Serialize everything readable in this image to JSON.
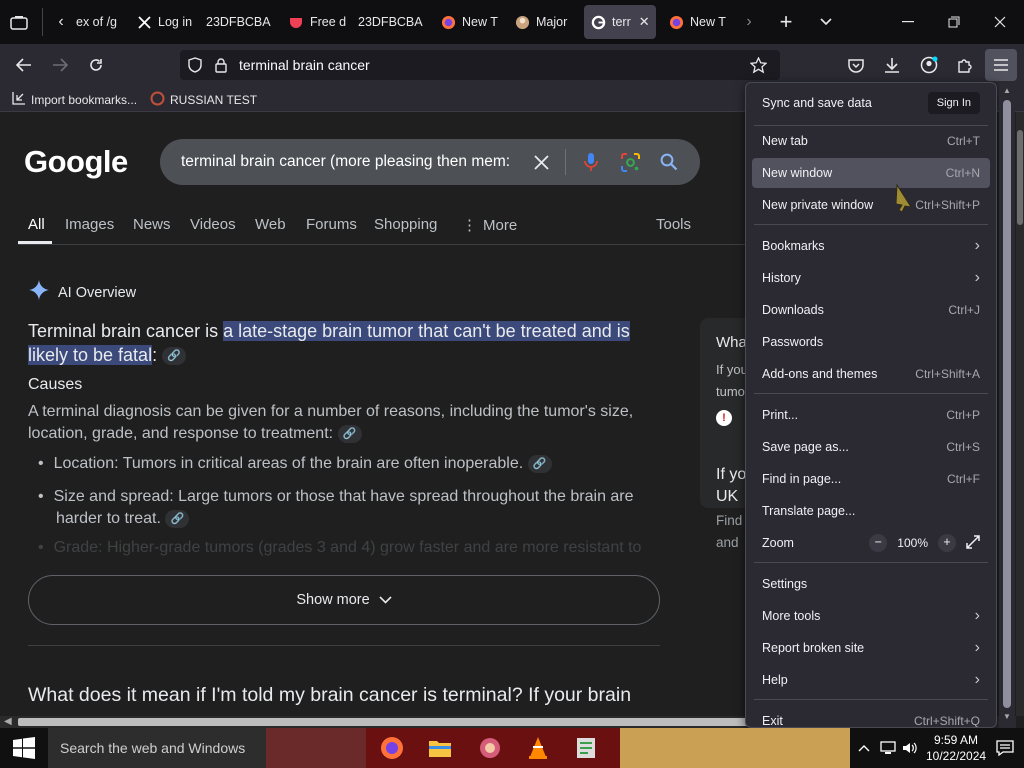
{
  "tabs": [
    {
      "label": "ex of /g",
      "icon": "page-icon"
    },
    {
      "label": "Log in",
      "icon": "x-logo-icon"
    },
    {
      "label": "23DFBCBA",
      "icon": "page-icon"
    },
    {
      "label": "Free d",
      "icon": "pocket-icon"
    },
    {
      "label": "23DFBCBA",
      "icon": "page-icon"
    },
    {
      "label": "New T",
      "icon": "firefox-icon"
    },
    {
      "label": "Major",
      "icon": "avatar-icon"
    },
    {
      "label": "terr",
      "icon": "google-icon"
    },
    {
      "label": "New T",
      "icon": "firefox-icon"
    }
  ],
  "urlbar": {
    "value": "terminal brain cancer"
  },
  "bookmarks": [
    {
      "label": "Import bookmarks..."
    },
    {
      "label": "RUSSIAN TEST"
    }
  ],
  "google": {
    "logo": "Google",
    "search_value": "terminal brain cancer (more pleasing then mem:",
    "tabs": [
      "All",
      "Images",
      "News",
      "Videos",
      "Web",
      "Forums",
      "Shopping",
      "More",
      "Tools"
    ],
    "ai_label": "AI Overview",
    "intro_prefix": "Terminal brain cancer is ",
    "intro_highlight_a": "a late-stage brain tumor that can't be treated and is",
    "intro_highlight_b": "likely to be fatal",
    "intro_suffix": ":",
    "causes_heading": "Causes",
    "causes_text_a": "A terminal diagnosis can be given for a number of reasons, including the tumor's size,",
    "causes_text_b": "location, grade, and response to treatment:",
    "bullet_1": "Location: Tumors in critical areas of the brain are often inoperable.",
    "bullet_2a": "Size and spread: Large tumors or those that have spread throughout the brain are",
    "bullet_2b": "harder to treat.",
    "bullet_3": "Grade: Higher-grade tumors (grades 3 and 4) grow faster and are more resistant to",
    "show_more": "Show more",
    "question": "What does it mean if I'm told my brain cancer is terminal? If your brain",
    "side_card": {
      "title": "Wha",
      "line1": "If you",
      "line2": "tumo",
      "title2a": "If yo",
      "title2b": "UK",
      "line3": "Find",
      "line4": "and"
    }
  },
  "menu": {
    "header": "Sync and save data",
    "sign_in": "Sign In",
    "items": [
      {
        "label": "New tab",
        "shortcut": "Ctrl+T"
      },
      {
        "label": "New window",
        "shortcut": "Ctrl+N"
      },
      {
        "label": "New private window",
        "shortcut": "Ctrl+Shift+P"
      },
      {
        "label": "Bookmarks",
        "shortcut": ""
      },
      {
        "label": "History",
        "shortcut": ""
      },
      {
        "label": "Downloads",
        "shortcut": "Ctrl+J"
      },
      {
        "label": "Passwords",
        "shortcut": ""
      },
      {
        "label": "Add-ons and themes",
        "shortcut": "Ctrl+Shift+A"
      },
      {
        "label": "Print...",
        "shortcut": "Ctrl+P"
      },
      {
        "label": "Save page as...",
        "shortcut": "Ctrl+S"
      },
      {
        "label": "Find in page...",
        "shortcut": "Ctrl+F"
      },
      {
        "label": "Translate page...",
        "shortcut": ""
      },
      {
        "label": "Zoom",
        "shortcut": ""
      },
      {
        "label": "Settings",
        "shortcut": ""
      },
      {
        "label": "More tools",
        "shortcut": ""
      },
      {
        "label": "Report broken site",
        "shortcut": ""
      },
      {
        "label": "Help",
        "shortcut": ""
      },
      {
        "label": "Exit",
        "shortcut": "Ctrl+Shift+Q"
      }
    ],
    "zoom_minus": "−",
    "zoom_value": "100%",
    "zoom_plus": "+"
  },
  "taskbar": {
    "search_placeholder": "Search the web and Windows",
    "time": "9:59 AM",
    "date": "10/22/2024"
  },
  "colors": {
    "accent": "#8ab4f8",
    "highlight": "#3b4a7a",
    "menu_bg": "#2b2a33",
    "menu_hover": "#52525e"
  }
}
